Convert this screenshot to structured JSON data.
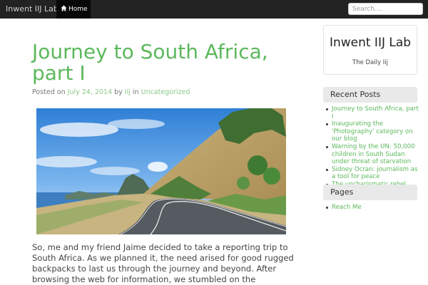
{
  "navbar": {
    "brand": "Inwent IIJ Lab",
    "home_label": "Home",
    "search_placeholder": "Search....",
    "home_icon": "home-icon"
  },
  "post": {
    "title": "Journey to South Africa, part I",
    "posted_on_label": "Posted on",
    "date": "July 24, 2014",
    "by_label": "by",
    "author": "Iij",
    "in_label": "in",
    "category": "Uncategorized",
    "body": "So, me and my friend Jaime decided to take a reporting trip to South Africa. As we planned it, the need arised for good rugged backpacks to last us through the journey and beyond. After browsing the web for information, we stumbled on the Rangermade website, where a"
  },
  "sidebar": {
    "site_title": "Inwent IIJ Lab",
    "tagline": "The Daily Iij",
    "recent_posts": {
      "heading": "Recent Posts",
      "items": [
        "Journey to South Africa, part I",
        "Inaugurating the 'Photography' category on our blog",
        "Warning by the UN: 50,000 children in South Sudan under threat of starvation",
        "Sidney Ocran: journalism as a tool for peace",
        "The uncharismatic rebel"
      ]
    },
    "pages": {
      "heading": "Pages",
      "items": [
        "Reach Me"
      ]
    }
  },
  "colors": {
    "navbar_bg": "#222222",
    "accent_green": "#5cb85c",
    "widget_head_bg": "#e9e9e9"
  }
}
